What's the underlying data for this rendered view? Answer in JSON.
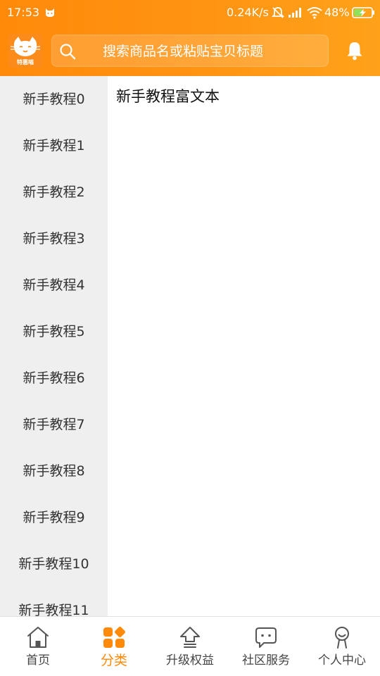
{
  "status_bar": {
    "time": "17:53",
    "net_speed": "0.24K/s",
    "battery": "48%"
  },
  "header": {
    "logo_text": "特惠喵",
    "search_placeholder": "搜索商品名或粘贴宝贝标题"
  },
  "sidebar": {
    "items": [
      {
        "label": "新手教程0"
      },
      {
        "label": "新手教程1"
      },
      {
        "label": "新手教程2"
      },
      {
        "label": "新手教程3"
      },
      {
        "label": "新手教程4"
      },
      {
        "label": "新手教程5"
      },
      {
        "label": "新手教程6"
      },
      {
        "label": "新手教程7"
      },
      {
        "label": "新手教程8"
      },
      {
        "label": "新手教程9"
      },
      {
        "label": "新手教程10"
      },
      {
        "label": "新手教程11"
      }
    ]
  },
  "content": {
    "text": "新手教程富文本"
  },
  "tabbar": {
    "tabs": [
      {
        "label": "首页",
        "icon": "home-icon"
      },
      {
        "label": "分类",
        "icon": "category-icon",
        "active": true
      },
      {
        "label": "升级权益",
        "icon": "upgrade-icon"
      },
      {
        "label": "社区服务",
        "icon": "chat-icon"
      },
      {
        "label": "个人中心",
        "icon": "profile-icon"
      }
    ]
  },
  "colors": {
    "accent": "#ff8a0a",
    "sidebar_bg": "#efefef",
    "text": "#333333"
  }
}
